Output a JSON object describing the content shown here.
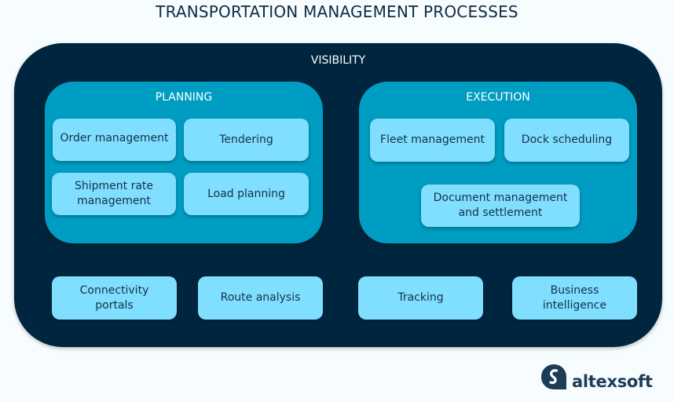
{
  "title": "TRANSPORTATION MANAGEMENT PROCESSES",
  "visibility": {
    "label": "VISIBILITY",
    "groups": [
      {
        "label": "PLANNING",
        "items": [
          "Order management",
          "Tendering",
          "Shipment rate management",
          "Load planning"
        ]
      },
      {
        "label": "EXECUTION",
        "items": [
          "Fleet management",
          "Dock scheduling",
          "Document management and settlement"
        ]
      }
    ],
    "bottom_items": [
      "Connectivity portals",
      "Route analysis",
      "Tracking",
      "Business intelligence"
    ]
  },
  "logo": {
    "icon": "altexsoft-logo-icon",
    "text": "altexsoft"
  },
  "colors": {
    "outer": "#00263f",
    "group": "#009dc3",
    "box": "#80deff",
    "box_text": "#13324a",
    "title_text": "#0f2b44"
  }
}
